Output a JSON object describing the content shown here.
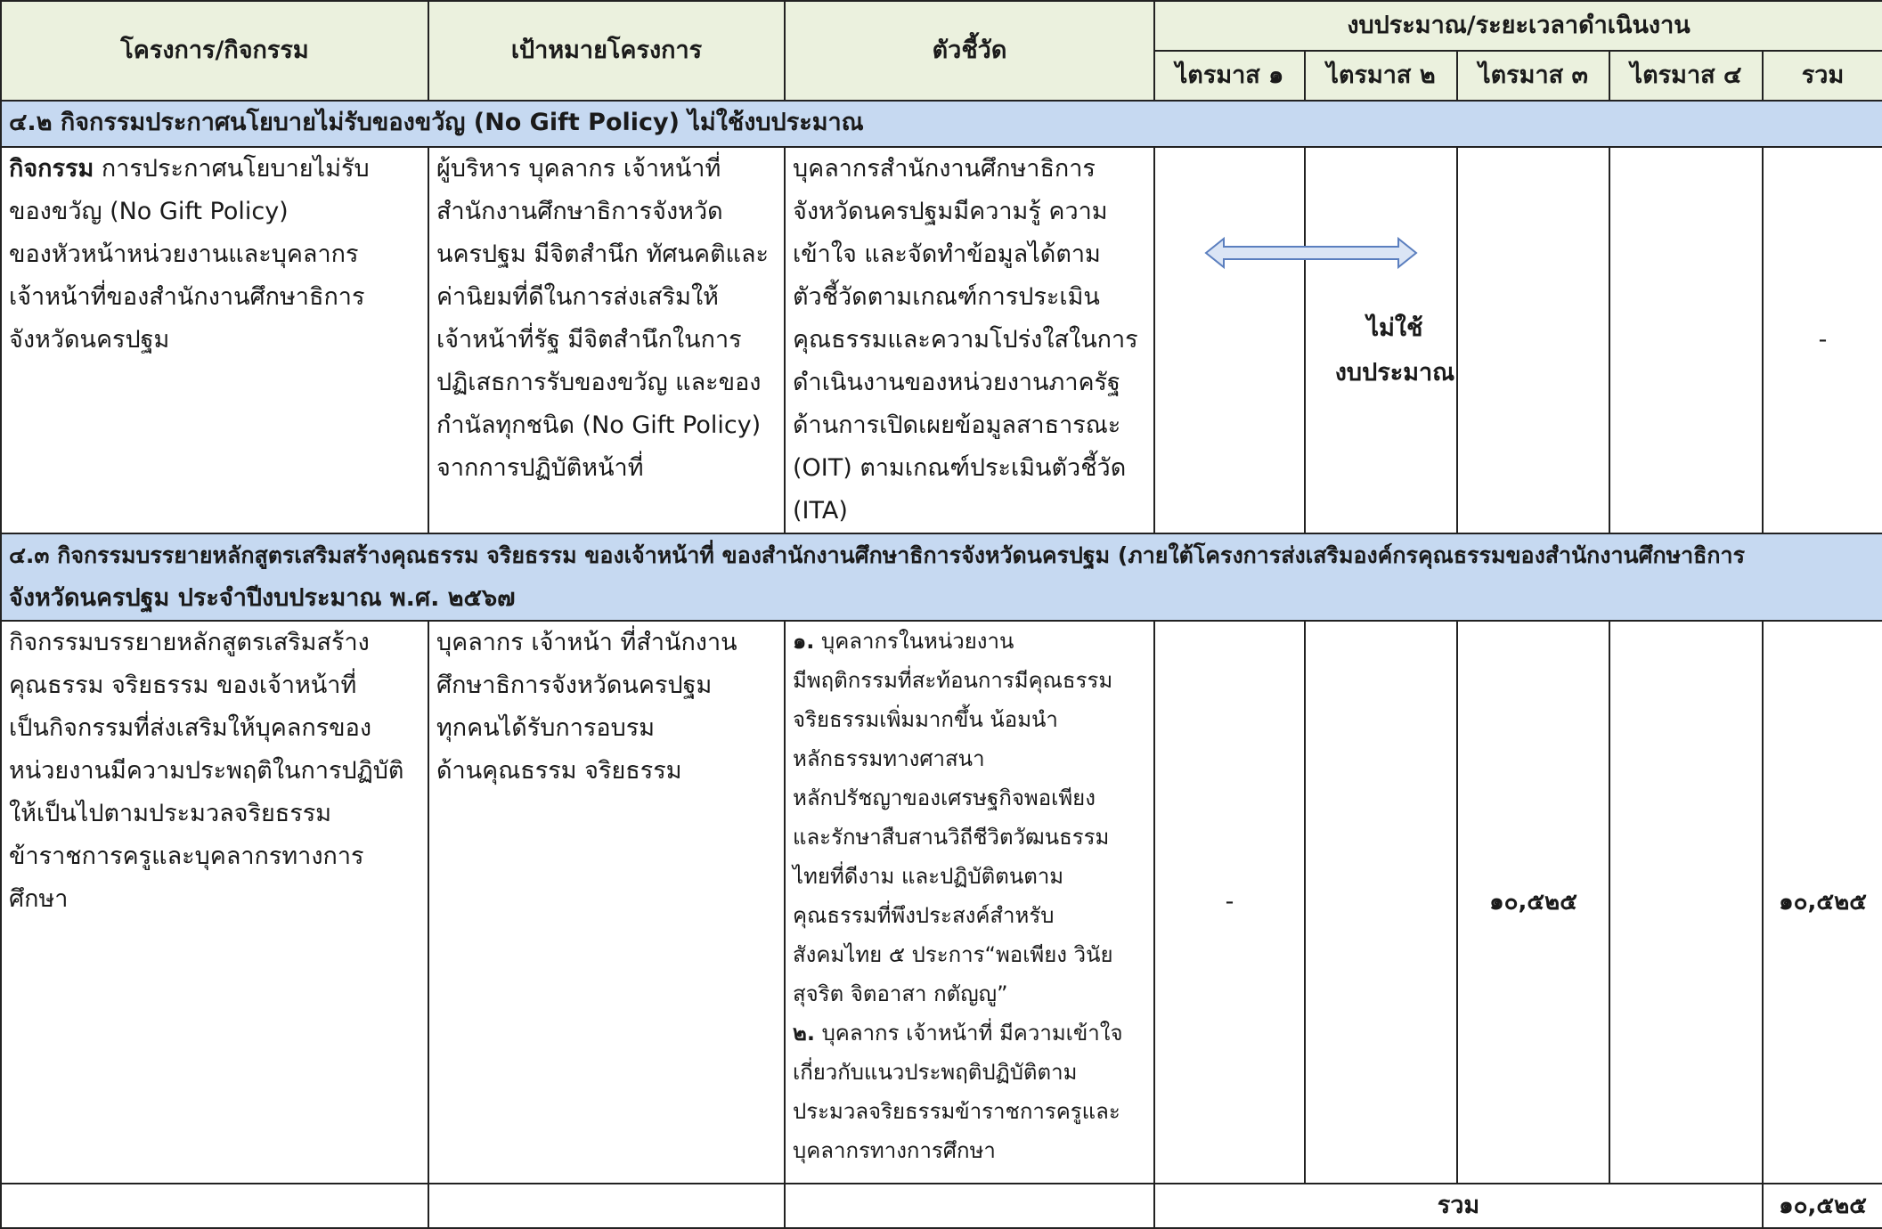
{
  "header": {
    "col_project": "โครงการ/กิจกรรม",
    "col_goal": "เป้าหมายโครงการ",
    "col_indicator": "ตัวชี้วัด",
    "col_budget": "งบประมาณ/ระยะเวลาดำเนินงาน",
    "q1": "ไตรมาส ๑",
    "q2": "ไตรมาส ๒",
    "q3": "ไตรมาส ๓",
    "q4": "ไตรมาส ๔",
    "total": "รวม"
  },
  "section42": {
    "title": "๔.๒ กิจกรรมประกาศนโยบายไม่รับของขวัญ (No Gift Policy) ไม่ใช้งบประมาณ",
    "activity_bold": "กิจกรรม",
    "activity_lines": [
      " การประกาศนโยบายไม่รับ",
      "ของขวัญ (No Gift Policy)",
      "ของหัวหน้าหน่วยงานและบุคลากร",
      "เจ้าหน้าที่ของสำนักงานศึกษาธิการ",
      "จังหวัดนครปฐม"
    ],
    "goal_lines": [
      "ผู้บริหาร บุคลากร เจ้าหน้าที่",
      "สำนักงานศึกษาธิการจังหวัด",
      "นครปฐม มีจิตสำนึก ทัศนคติและ",
      "ค่านิยมที่ดีในการส่งเสริมให้",
      "เจ้าหน้าที่รัฐ มีจิตสำนึกในการ",
      "ปฏิเสธการรับของขวัญ และของ",
      "กำนัลทุกชนิด (No Gift Policy)",
      "จากการปฏิบัติหน้าที่"
    ],
    "indicator_lines": [
      "บุคลากรสำนักงานศึกษาธิการ",
      "จังหวัดนครปฐมมีความรู้ ความ",
      "เข้าใจ และจัดทำข้อมูลได้ตาม",
      "ตัวชี้วัดตามเกณฑ์การประเมิน",
      "คุณธรรมและความโปร่งใสในการ",
      "ดำเนินงานของหน่วยงานภาครัฐ",
      "ด้านการเปิดเผยข้อมูลสาธารณะ",
      "(OIT) ตามเกณฑ์ประเมินตัวชี้วัด",
      "(ITA)"
    ],
    "no_budget_line1": "ไม่ใช้",
    "no_budget_line2": "งบประมาณ",
    "total": "-"
  },
  "section43": {
    "title_line1": "๔.๓ กิจกรรมบรรยายหลักสูตรเสริมสร้างคุณธรรม จริยธรรม ของเจ้าหน้าที่ ของสำนักงานศึกษาธิการจังหวัดนครปฐม (ภายใต้โครงการส่งเสริมองค์กรคุณธรรมของสำนักงานศึกษาธิการ",
    "title_line2": "จังหวัดนครปฐม ประจำปีงบประมาณ พ.ศ. ๒๕๖๗",
    "activity_lines": [
      "กิจกรรมบรรยายหลักสูตรเสริมสร้าง",
      "คุณธรรม จริยธรรม ของเจ้าหน้าที่",
      "เป็นกิจกรรมที่ส่งเสริมให้บุคลกรของ",
      "หน่วยงานมีความประพฤติในการปฏิบัติ",
      "ให้เป็นไปตามประมวลจริยธรรม",
      "ข้าราชการครูและบุคลากรทางการ",
      "ศึกษา"
    ],
    "goal_lines": [
      "บุคลากร เจ้าหน้า ที่สำนักงาน",
      "ศึกษาธิการจังหวัดนครปฐม",
      "ทุกคนได้รับการอบรม",
      "ด้านคุณธรรม จริยธรรม"
    ],
    "indicator1_num": "๑.",
    "indicator1_lines": [
      " บุคลากรในหน่วยงาน",
      "มีพฤติกรรมที่สะท้อนการมีคุณธรรม",
      "จริยธรรมเพิ่มมากขึ้น น้อมนำ",
      "หลักธรรมทางศาสนา",
      "หลักปรัชญาของเศรษฐกิจพอเพียง",
      "และรักษาสืบสานวิถีชีวิตวัฒนธรรม",
      "ไทยที่ดีงาม และปฏิบัติตนตาม",
      "คุณธรรมที่พึงประสงค์สำหรับ",
      "สังคมไทย ๕ ประการ“พอเพียง วินัย",
      "สุจริต จิตอาสา กตัญญู”"
    ],
    "indicator2_num": "๒.",
    "indicator2_lines": [
      " บุคลากร เจ้าหน้าที่ มีความเข้าใจ",
      "เกี่ยวกับแนวประพฤติปฏิบัติตาม",
      "ประมวลจริยธรรมข้าราชการครูและ",
      "บุคลากรทางการศึกษา"
    ],
    "q1": "-",
    "q3": "๑๐,๕๒๕",
    "total": "๑๐,๕๒๕"
  },
  "footer": {
    "label": "รวม",
    "total": "๑๐,๕๒๕"
  }
}
